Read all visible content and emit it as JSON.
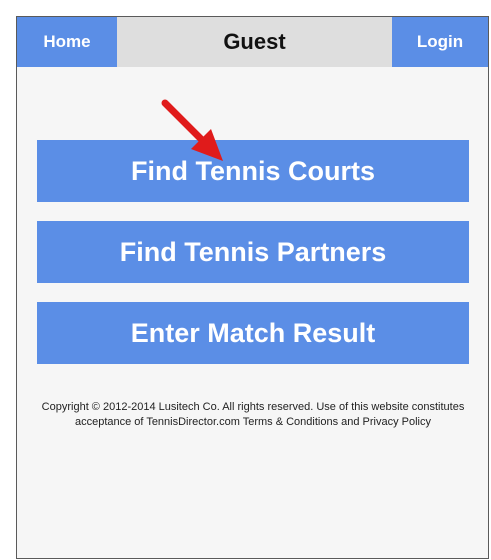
{
  "header": {
    "home_label": "Home",
    "title": "Guest",
    "login_label": "Login"
  },
  "actions": {
    "find_courts": "Find Tennis Courts",
    "find_partners": "Find Tennis Partners",
    "enter_result": "Enter Match Result"
  },
  "footer": {
    "copyright": "Copyright © 2012-2014 Lusitech Co. All rights reserved. Use of this website constitutes acceptance of TennisDirector.com Terms & Conditions and Privacy Policy"
  },
  "colors": {
    "button_blue": "#5b8ee6",
    "header_gray": "#dedede",
    "arrow_red": "#e01b1b"
  },
  "annotation": {
    "arrow_icon": "red-arrow-icon"
  }
}
